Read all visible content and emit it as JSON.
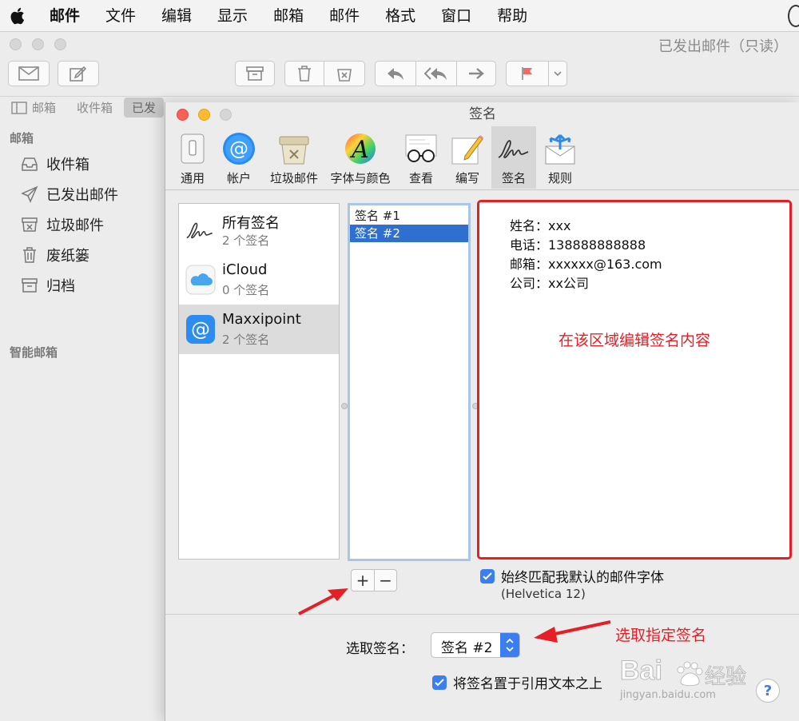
{
  "menubar": {
    "items": [
      "邮件",
      "文件",
      "编辑",
      "显示",
      "邮箱",
      "邮件",
      "格式",
      "窗口",
      "帮助"
    ]
  },
  "mail_window": {
    "title": "已发出邮件（只读）",
    "favorites": [
      "邮箱",
      "收件箱",
      "已发"
    ],
    "sidebar": {
      "heading": "邮箱",
      "items": [
        "收件箱",
        "已发出邮件",
        "垃圾邮件",
        "废纸篓",
        "归档"
      ],
      "smart_heading": "智能邮箱"
    }
  },
  "prefs": {
    "title": "签名",
    "tabs": [
      "通用",
      "帐户",
      "垃圾邮件",
      "字体与颜色",
      "查看",
      "编写",
      "签名",
      "规则"
    ],
    "active_tab": "签名",
    "accounts": [
      {
        "name": "所有签名",
        "count": "2 个签名"
      },
      {
        "name": "iCloud",
        "count": "0 个签名"
      },
      {
        "name": "Maxxipoint",
        "count": "2 个签名"
      }
    ],
    "signatures": [
      "签名 #1",
      "签名 #2"
    ],
    "selected_signature": "签名 #2",
    "signature_content": [
      "姓名：xxx",
      "电话：138888888888",
      "邮箱：xxxxxx@163.com",
      "公司：xx公司"
    ],
    "editor_hint": "在该区域编辑签名内容",
    "add_label": "+",
    "remove_label": "−",
    "match_font_label": "始终匹配我默认的邮件字体",
    "font_note": "(Helvetica 12)",
    "choose_label": "选取签名：",
    "choose_value": "签名 #2",
    "place_above_label": "将签名置于引用文本之上"
  },
  "annotations": {
    "choose_hint": "选取指定签名",
    "accent_red": "#e51f25",
    "accent_blue": "#3b7ef0"
  },
  "watermark": {
    "brand": "Bai",
    "brand2": "经验",
    "url": "jingyan.baidu.com",
    "help": "?"
  }
}
